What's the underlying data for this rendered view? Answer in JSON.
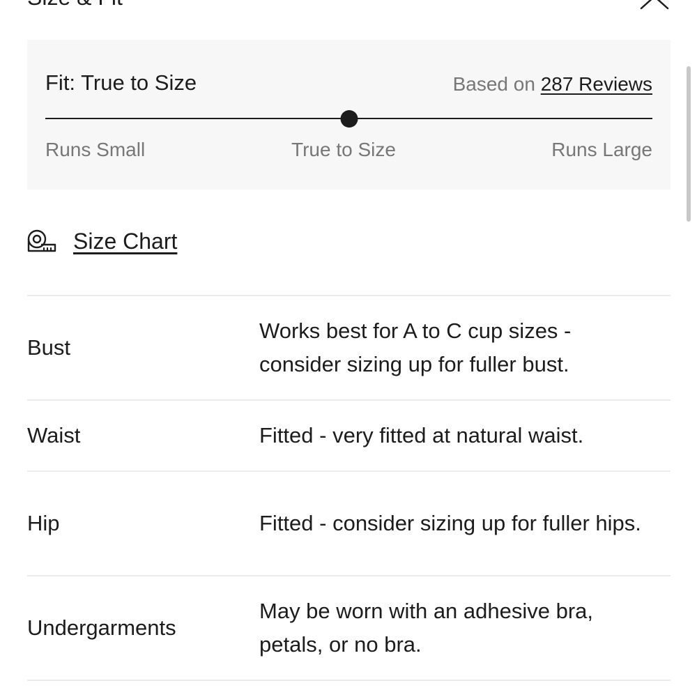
{
  "header": {
    "title": "Size & Fit"
  },
  "fit": {
    "title": "Fit: True to Size",
    "reviews_prefix": "Based on ",
    "reviews_link": "287 Reviews",
    "scale_min_label": "Runs Small",
    "scale_mid_label": "True to Size",
    "scale_max_label": "Runs Large",
    "position_fraction": 0.5
  },
  "size_chart": {
    "label": "Size Chart",
    "icon": "measuring-tape-icon"
  },
  "fit_details": [
    {
      "label": "Bust",
      "value": "Works best for A to C cup sizes - consider sizing up for fuller bust."
    },
    {
      "label": "Waist",
      "value": "Fitted - very fitted at natural waist."
    },
    {
      "label": "Hip",
      "value": "Fitted - consider sizing up for fuller hips."
    },
    {
      "label": "Undergarments",
      "value": "May be worn with an adhesive bra, petals, or no bra."
    }
  ],
  "colors": {
    "panel_background": "#f7f7f7",
    "text_primary": "#1c1c1c",
    "text_secondary": "#777777",
    "divider": "#ebebeb"
  }
}
